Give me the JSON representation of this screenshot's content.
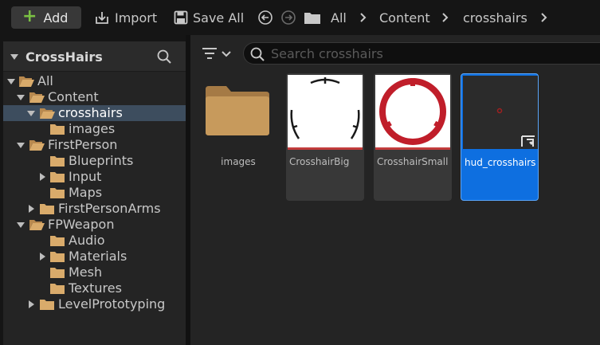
{
  "toolbar": {
    "add_label": "Add",
    "import_label": "Import",
    "save_all_label": "Save All",
    "breadcrumb": [
      "All",
      "Content",
      "crosshairs"
    ]
  },
  "sources": {
    "title": "CrossHairs",
    "tree": [
      {
        "label": "All",
        "expanded": true
      },
      {
        "label": "Content",
        "expanded": true
      },
      {
        "label": "crosshairs",
        "expanded": true,
        "selected": true
      },
      {
        "label": "images"
      },
      {
        "label": "FirstPerson",
        "expanded": true
      },
      {
        "label": "Blueprints"
      },
      {
        "label": "Input",
        "expandable": true
      },
      {
        "label": "Maps"
      },
      {
        "label": "FirstPersonArms",
        "expandable": true
      },
      {
        "label": "FPWeapon",
        "expanded": true
      },
      {
        "label": "Audio"
      },
      {
        "label": "Materials",
        "expandable": true
      },
      {
        "label": "Mesh"
      },
      {
        "label": "Textures"
      },
      {
        "label": "LevelPrototyping",
        "expandable": true
      }
    ]
  },
  "content": {
    "search_placeholder": "Search crosshairs",
    "assets": [
      {
        "name": "images",
        "kind": "folder"
      },
      {
        "name": "CrosshairBig",
        "kind": "texture"
      },
      {
        "name": "CrosshairSmall",
        "kind": "texture"
      },
      {
        "name": "hud_crosshairs",
        "kind": "widget",
        "selected": true
      }
    ]
  },
  "colors": {
    "accent_selected": "#0e6fe0",
    "add_plus": "#7ac043",
    "texture_bar": "#c23c3c",
    "crosshair_red": "#c01e2a",
    "folder": "#c79a5c"
  }
}
